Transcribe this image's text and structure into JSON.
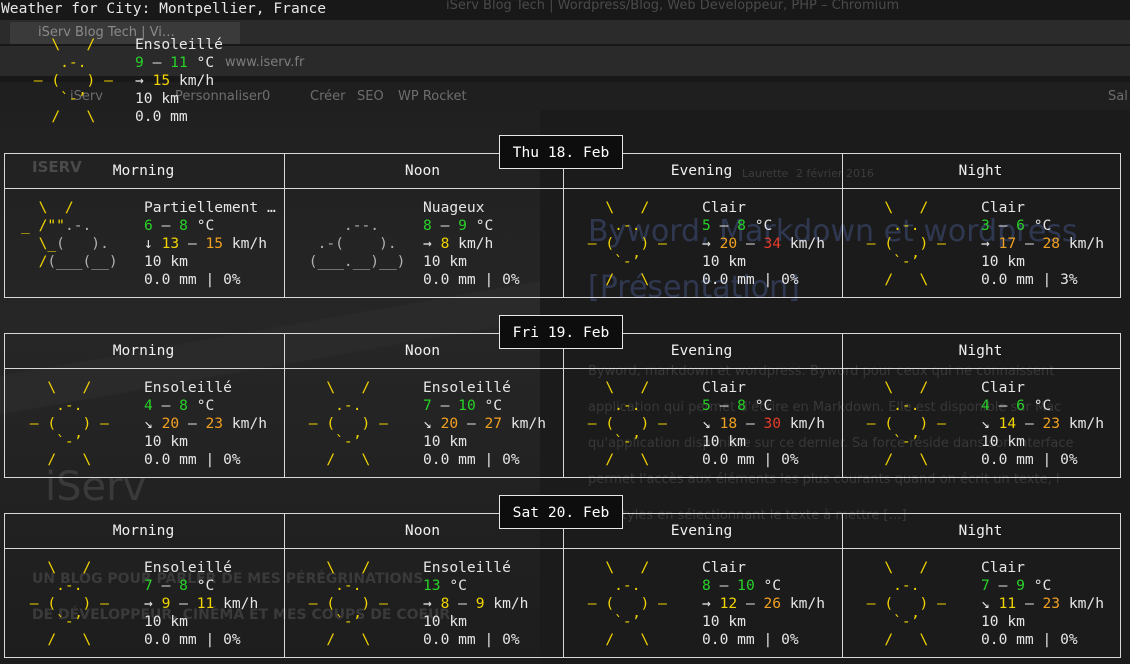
{
  "header": {
    "title": "Weather for City: Montpellier, France"
  },
  "current": {
    "description": "Ensoleillé",
    "temp_low": "9",
    "temp_high": "11",
    "temp_unit": "°C",
    "wind_arrow": "→",
    "wind": "15",
    "wind_unit": "km/h",
    "visibility": "10 km",
    "precip": "0.0 mm"
  },
  "periods": [
    "Morning",
    "Noon",
    "Evening",
    "Night"
  ],
  "days": [
    {
      "label": "Thu 18. Feb",
      "slots": [
        {
          "desc": "Partiellement …",
          "temp": [
            "6",
            "8"
          ],
          "arrow": "↓",
          "wind": [
            "13",
            "15"
          ],
          "vis": "10 km",
          "rain": "0.0 mm | 0%"
        },
        {
          "desc": "Nuageux",
          "temp": [
            "8",
            "9"
          ],
          "arrow": "→",
          "wind": [
            "8"
          ],
          "vis": "10 km",
          "rain": "0.0 mm | 0%"
        },
        {
          "desc": "Clair",
          "temp": [
            "5",
            "8"
          ],
          "arrow": "→",
          "wind": [
            "20",
            "34"
          ],
          "vis": "10 km",
          "rain": "0.0 mm | 0%"
        },
        {
          "desc": "Clair",
          "temp": [
            "3",
            "6"
          ],
          "arrow": "→",
          "wind": [
            "17",
            "28"
          ],
          "vis": "10 km",
          "rain": "0.0 mm | 3%"
        }
      ]
    },
    {
      "label": "Fri 19. Feb",
      "slots": [
        {
          "desc": "Ensoleillé",
          "temp": [
            "4",
            "8"
          ],
          "arrow": "↘",
          "wind": [
            "20",
            "23"
          ],
          "vis": "10 km",
          "rain": "0.0 mm | 0%"
        },
        {
          "desc": "Ensoleillé",
          "temp": [
            "7",
            "10"
          ],
          "arrow": "↘",
          "wind": [
            "20",
            "27"
          ],
          "vis": "10 km",
          "rain": "0.0 mm | 0%"
        },
        {
          "desc": "Clair",
          "temp": [
            "5",
            "8"
          ],
          "arrow": "↘",
          "wind": [
            "18",
            "30"
          ],
          "vis": "10 km",
          "rain": "0.0 mm | 0%"
        },
        {
          "desc": "Clair",
          "temp": [
            "4",
            "6"
          ],
          "arrow": "↘",
          "wind": [
            "14",
            "23"
          ],
          "vis": "10 km",
          "rain": "0.0 mm | 0%"
        }
      ]
    },
    {
      "label": "Sat 20. Feb",
      "slots": [
        {
          "desc": "Ensoleillé",
          "temp": [
            "7",
            "8"
          ],
          "arrow": "→",
          "wind": [
            "9",
            "11"
          ],
          "vis": "10 km",
          "rain": "0.0 mm | 0%"
        },
        {
          "desc": "Ensoleillé",
          "temp": [
            "13"
          ],
          "arrow": "→",
          "wind": [
            "8",
            "9"
          ],
          "vis": "10 km",
          "rain": "0.0 mm | 0%"
        },
        {
          "desc": "Clair",
          "temp": [
            "8",
            "10"
          ],
          "arrow": "→",
          "wind": [
            "12",
            "26"
          ],
          "vis": "10 km",
          "rain": "0.0 mm | 0%"
        },
        {
          "desc": "Clair",
          "temp": [
            "7",
            "9"
          ],
          "arrow": "↘",
          "wind": [
            "11",
            "23"
          ],
          "vis": "10 km",
          "rain": "0.0 mm | 0%"
        }
      ]
    }
  ],
  "background": {
    "tab_title": "iServ Blog Tech | Vi…",
    "url": "www.iserv.fr",
    "window_title": "iServ Blog Tech | Wordpress/Blog, Web Developpeur, PHP – Chromium",
    "admin_items": [
      "iServ",
      "Personnaliser",
      "0",
      "Créer",
      "SEO",
      "WP Rocket",
      "Sal"
    ],
    "site_name": "ISERV",
    "post_meta": "Laurette",
    "post_date": "2 février 2016",
    "post_title_1": "Byword, Markdown et wordpress",
    "post_title_2": "[Présentation]",
    "post_excerpt_1": "Byword, markdown et wordpress. Byword pour ceux qui ne connaissent",
    "post_excerpt_2": "application qui permet d'écrire en Markdown. Elle est disponible sur Mac",
    "post_excerpt_3": "qu'application disponible sur ce dernier. Sa force réside dans son interface",
    "post_excerpt_4": "permet l'accès aux éléments les plus courants quand on écrit un texte, l",
    "post_excerpt_5": "des styles en sélectionnant le texte à mettre […]",
    "logo_text": "iServ",
    "tagline_1": "UN BLOG POUR PARLER DE MES PÉRÉGRINATIONS",
    "tagline_2": "DE DÉVELOPPEUR, CINÉMA ET MES COUPS DE COEUR."
  },
  "colors": {
    "sun": "#f2d400",
    "temp": "#28d228",
    "wind_mid": "#f0a020",
    "wind_high": "#e53c2a"
  }
}
